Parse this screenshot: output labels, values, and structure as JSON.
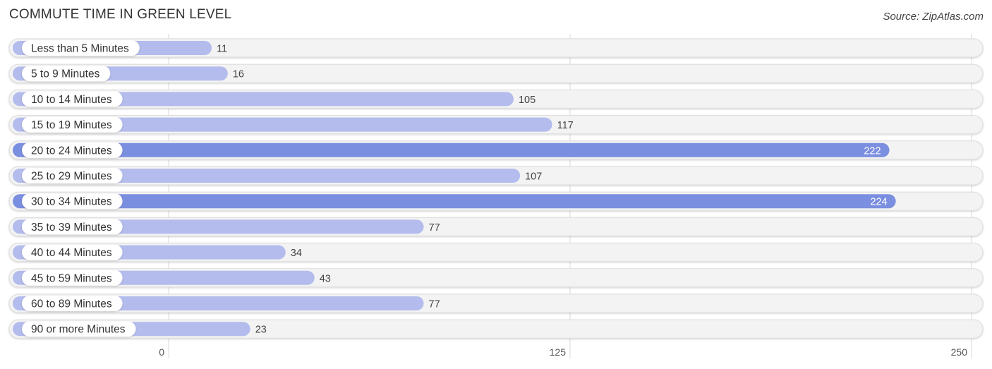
{
  "header": {
    "title": "COMMUTE TIME IN GREEN LEVEL",
    "source": "Source: ZipAtlas.com"
  },
  "chart_data": {
    "type": "bar",
    "orientation": "horizontal",
    "title": "COMMUTE TIME IN GREEN LEVEL",
    "xlabel": "",
    "ylabel": "",
    "categories": [
      "Less than 5 Minutes",
      "5 to 9 Minutes",
      "10 to 14 Minutes",
      "15 to 19 Minutes",
      "20 to 24 Minutes",
      "25 to 29 Minutes",
      "30 to 34 Minutes",
      "35 to 39 Minutes",
      "40 to 44 Minutes",
      "45 to 59 Minutes",
      "60 to 89 Minutes",
      "90 or more Minutes"
    ],
    "values": [
      11,
      16,
      105,
      117,
      222,
      107,
      224,
      77,
      34,
      43,
      77,
      23
    ],
    "xlim": [
      0,
      250
    ],
    "xticks": [
      0,
      125,
      250
    ],
    "grid": true,
    "legend": "none",
    "colors": {
      "bar_light": "#b3bcec",
      "bar_dark": "#7b8fe0",
      "track": "#f3f3f3",
      "track_border": "#dddddd",
      "label_pill": "#ffffff"
    }
  }
}
